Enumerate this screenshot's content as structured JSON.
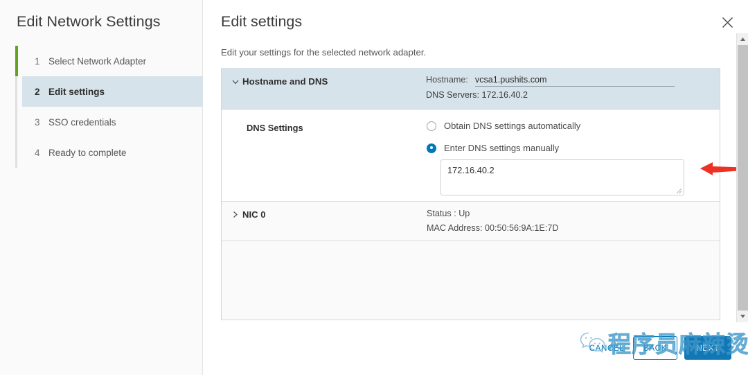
{
  "wizard": {
    "title": "Edit Network Settings",
    "steps": [
      {
        "num": "1",
        "label": "Select Network Adapter"
      },
      {
        "num": "2",
        "label": "Edit settings"
      },
      {
        "num": "3",
        "label": "SSO credentials"
      },
      {
        "num": "4",
        "label": "Ready to complete"
      }
    ]
  },
  "pane": {
    "title": "Edit settings",
    "subtitle": "Edit your settings for the selected network adapter.",
    "close_icon": "close-icon"
  },
  "hostname_section": {
    "caret_icon": "chevron-down-icon",
    "label": "Hostname and DNS",
    "hostname_key": "Hostname:",
    "hostname_value": "vcsa1.pushits.com",
    "dns_servers_text": "DNS Servers: 172.16.40.2"
  },
  "dns_settings": {
    "label": "DNS Settings",
    "options": [
      {
        "label": "Obtain DNS settings automatically",
        "selected": false
      },
      {
        "label": "Enter DNS settings manually",
        "selected": true
      }
    ],
    "textarea_value": "172.16.40.2",
    "resize_grip_icon": "resize-grip-icon",
    "annotation_icon": "red-arrow-annotation"
  },
  "nic_section": {
    "caret_icon": "chevron-right-icon",
    "label": "NIC 0",
    "status": "Status : Up",
    "mac": "MAC Address: 00:50:56:9A:1E:7D"
  },
  "scrollbar": {
    "up_icon": "scroll-up-arrow-icon",
    "down_icon": "scroll-down-arrow-icon"
  },
  "footer": {
    "cancel_label": "CANCEL",
    "back_label": "BACK",
    "next_label": "NEXT"
  },
  "watermark": {
    "logo_icon": "wechat-logo-icon",
    "text": "程序员麻辣烫"
  },
  "colors": {
    "accent_blue": "#0079b8",
    "next_button_blue": "#1177b5",
    "progress_green": "#62a420",
    "section_header_bg": "#d7e3ea",
    "annotation_red": "#ee3124"
  }
}
